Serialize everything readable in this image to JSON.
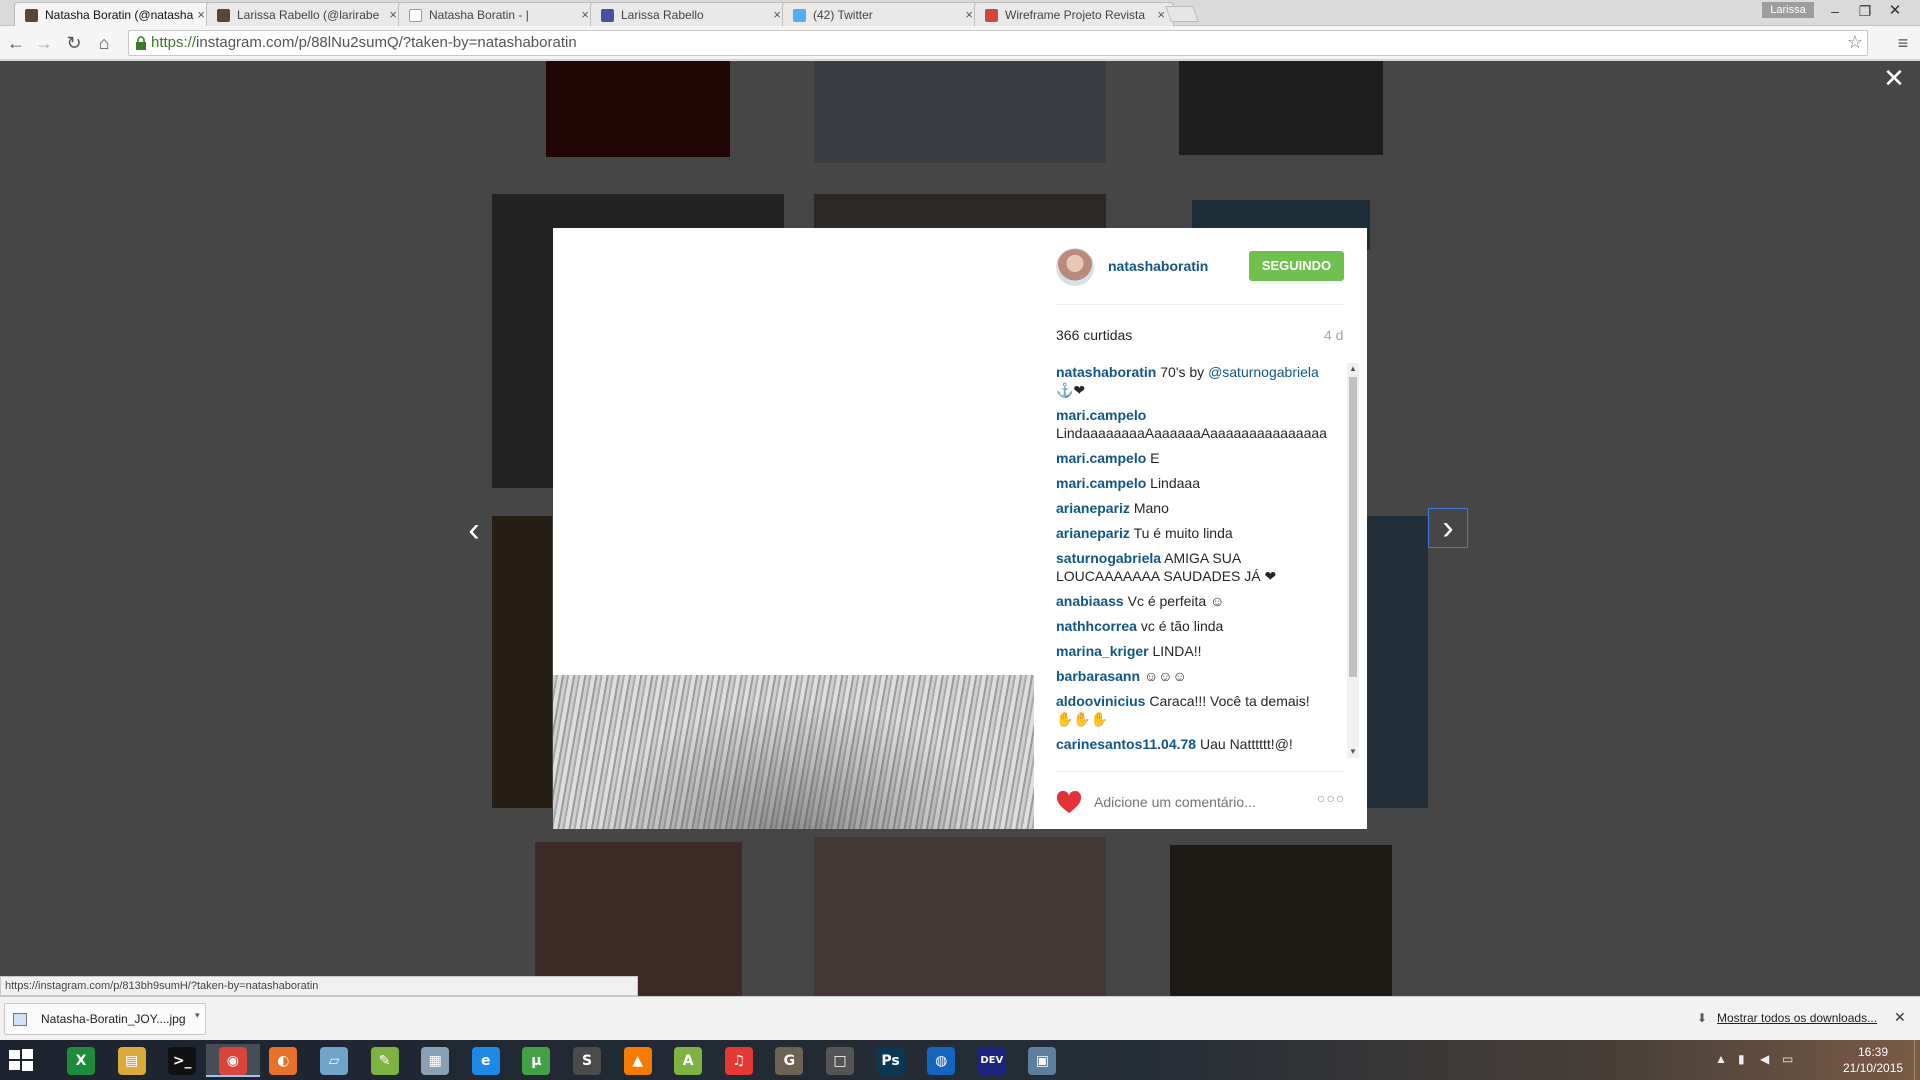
{
  "browser": {
    "tabs": [
      {
        "title": "Natasha Boratin (@natasha",
        "active": true,
        "icon": "instagram-favicon"
      },
      {
        "title": "Larissa Rabello (@larirabe",
        "active": false,
        "icon": "instagram-favicon"
      },
      {
        "title": "Natasha Boratin - |",
        "active": false,
        "icon": "page-favicon"
      },
      {
        "title": "Larissa Rabello",
        "active": false,
        "icon": "facebook-favicon"
      },
      {
        "title": "(42) Twitter",
        "active": false,
        "icon": "twitter-favicon"
      },
      {
        "title": "Wireframe Projeto Revista",
        "active": false,
        "icon": "gmail-favicon"
      }
    ],
    "profile_name": "Larissa",
    "url_prefix": "https://",
    "url_rest": "instagram.com/p/88lNu2sumQ/?taken-by=natashaboratin",
    "status_url": "https://instagram.com/p/813bh9sumH/?taken-by=natashaboratin"
  },
  "post": {
    "username": "natashaboratin",
    "follow_label": "SEGUINDO",
    "likes": "366 curtidas",
    "age": "4 d",
    "comments": [
      {
        "user": "natashaboratin",
        "text": "70's by ",
        "mention": "@saturnogabriela",
        "tail": " ⚓❤"
      },
      {
        "user": "mari.campelo",
        "text": "LindaaaaaaaaAaaaaaaAaaaaaaaaaaaaaaa"
      },
      {
        "user": "mari.campelo",
        "text": "E"
      },
      {
        "user": "mari.campelo",
        "text": "Lindaaa"
      },
      {
        "user": "arianepariz",
        "text": "Mano"
      },
      {
        "user": "arianepariz",
        "text": "Tu é muito linda"
      },
      {
        "user": "saturnogabriela",
        "text": "AMIGA SUA LOUCAAAAAAA SAUDADES JÁ ❤"
      },
      {
        "user": "anabiaass",
        "text": "Vc é perfeita ☺"
      },
      {
        "user": "nathhcorrea",
        "text": "vc é tão linda"
      },
      {
        "user": "marina_kriger",
        "text": "LINDA!!"
      },
      {
        "user": "barbarasann",
        "text": "☺☺☺"
      },
      {
        "user": "aldoovinicius",
        "text": "Caraca!!! Você ta demais! ✋✋✋"
      },
      {
        "user": "carinesantos11.04.78",
        "text": "Uau Natttttt!@!"
      }
    ],
    "comment_placeholder": "Adicione um comentário...",
    "more_label": "○○○"
  },
  "downloads": {
    "file_name": "Natasha-Boratin_JOY....jpg",
    "show_all": "Mostrar todos os downloads..."
  },
  "taskbar": {
    "apps": [
      {
        "name": "excel-icon",
        "glyph": "X",
        "color": "#1e8b3a"
      },
      {
        "name": "file-explorer-icon",
        "glyph": "▤",
        "color": "#d9a93a"
      },
      {
        "name": "cmd-icon",
        "glyph": ">_",
        "color": "#111111"
      },
      {
        "name": "chrome-icon",
        "glyph": "◉",
        "color": "#d8463a"
      },
      {
        "name": "firefox-icon",
        "glyph": "◐",
        "color": "#e8722a"
      },
      {
        "name": "app-icon",
        "glyph": "▱",
        "color": "#6fa3c9"
      },
      {
        "name": "notepad-icon",
        "glyph": "✎",
        "color": "#7cb342"
      },
      {
        "name": "calculator-icon",
        "glyph": "▦",
        "color": "#8aa0b6"
      },
      {
        "name": "internet-explorer-icon",
        "glyph": "e",
        "color": "#1e88e5"
      },
      {
        "name": "utorrent-icon",
        "glyph": "µ",
        "color": "#43a047"
      },
      {
        "name": "sublime-text-icon",
        "glyph": "S",
        "color": "#4b4b4b"
      },
      {
        "name": "vlc-icon",
        "glyph": "▲",
        "color": "#f57c00"
      },
      {
        "name": "android-studio-icon",
        "glyph": "A",
        "color": "#7cb342"
      },
      {
        "name": "itunes-icon",
        "glyph": "♫",
        "color": "#e53935"
      },
      {
        "name": "gimp-icon",
        "glyph": "G",
        "color": "#6d6253"
      },
      {
        "name": "window-app-icon",
        "glyph": "□",
        "color": "#555555"
      },
      {
        "name": "photoshop-icon",
        "glyph": "Ps",
        "color": "#0b3654"
      },
      {
        "name": "globe-icon",
        "glyph": "◍",
        "color": "#1565c0"
      },
      {
        "name": "dev-cpp-icon",
        "glyph": "DEV",
        "color": "#1a237e"
      },
      {
        "name": "remote-desktop-icon",
        "glyph": "▣",
        "color": "#5c7f9e"
      }
    ],
    "time": "16:39",
    "date": "21/10/2015"
  }
}
